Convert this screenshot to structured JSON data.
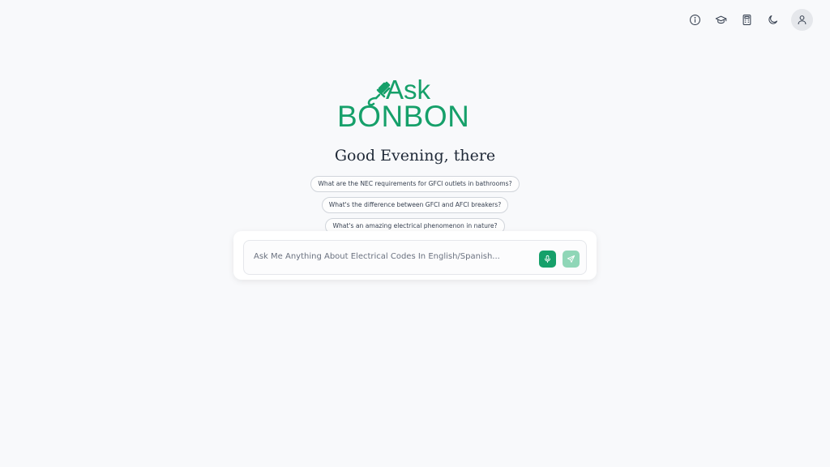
{
  "topbar": {
    "icons": [
      "info-icon",
      "graduation-cap-icon",
      "calculator-icon",
      "moon-icon",
      "user-icon"
    ]
  },
  "logo": {
    "line1": "Ask",
    "line2": "BONBON",
    "color": "#16a06a"
  },
  "greeting": "Good Evening, there",
  "suggestions": [
    "What are the NEC requirements for GFCI outlets in bathrooms?",
    "What's the difference between GFCI and AFCI breakers?",
    "What's an amazing electrical phenomenon in nature?"
  ],
  "chat": {
    "placeholder": "Ask Me Anything About Electrical Codes In English/Spanish...",
    "mic_color": "#16a06a",
    "send_color": "#8fd6b7"
  }
}
